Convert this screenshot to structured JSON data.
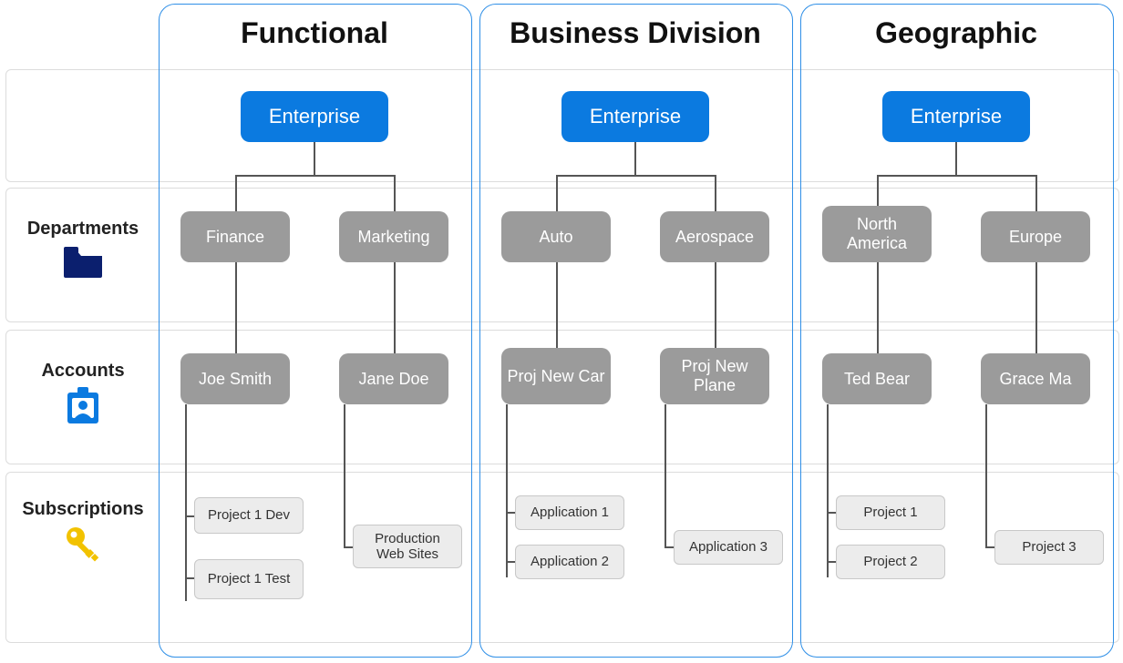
{
  "row_labels": {
    "departments": "Departments",
    "accounts": "Accounts",
    "subscriptions": "Subscriptions"
  },
  "columns": [
    {
      "title": "Functional",
      "enterprise": "Enterprise",
      "departments": [
        "Finance",
        "Marketing"
      ],
      "accounts": [
        "Joe Smith",
        "Jane Doe"
      ],
      "subscriptions": {
        "left": [
          "Project 1 Dev",
          "Project 1 Test"
        ],
        "right": [
          "Production Web Sites"
        ]
      }
    },
    {
      "title": "Business Division",
      "enterprise": "Enterprise",
      "departments": [
        "Auto",
        "Aerospace"
      ],
      "accounts": [
        "Proj New Car",
        "Proj New Plane"
      ],
      "subscriptions": {
        "left": [
          "Application 1",
          "Application 2"
        ],
        "right": [
          "Application 3"
        ]
      }
    },
    {
      "title": "Geographic",
      "enterprise": "Enterprise",
      "departments": [
        "North America",
        "Europe"
      ],
      "accounts": [
        "Ted Bear",
        "Grace Ma"
      ],
      "subscriptions": {
        "left": [
          "Project 1",
          "Project 2"
        ],
        "right": [
          "Project 3"
        ]
      }
    }
  ],
  "colors": {
    "columnFrame": "#2F8FE7",
    "enterprise": "#0b7ae0",
    "deptAcct": "#9b9b9b",
    "subBg": "#ececec",
    "subBorder": "#c8c8c8",
    "folderIcon": "#0b1f6e",
    "badgeIcon": "#0b7ae0",
    "keyIcon": "#f2c200"
  }
}
